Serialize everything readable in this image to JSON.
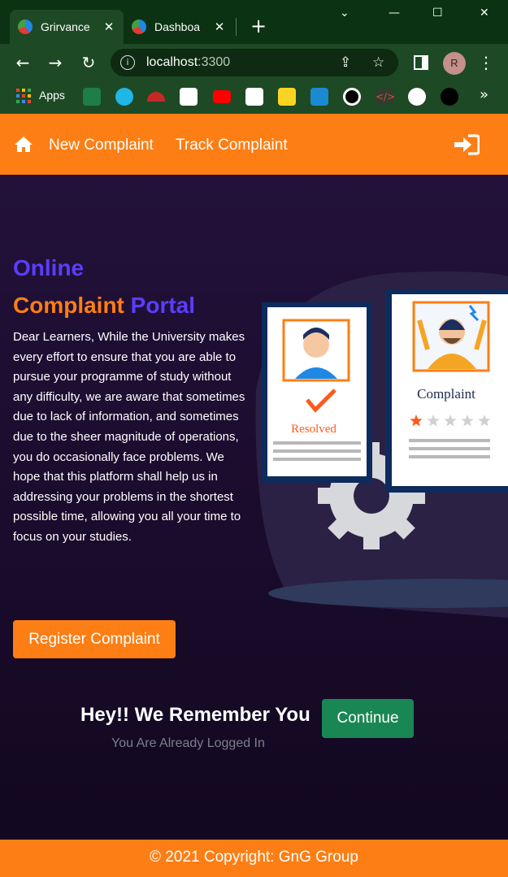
{
  "browser": {
    "tabs": [
      {
        "title": "Grirvance",
        "close": "✕"
      },
      {
        "title": "Dashboa",
        "close": "✕"
      }
    ],
    "new_tab": "+",
    "address": {
      "host": "localhost",
      "port": ":3300"
    },
    "profile_initial": "R",
    "bookmarks": {
      "apps_label": "Apps",
      "overflow": "»"
    }
  },
  "navbar": {
    "links": [
      "New Complaint",
      "Track Complaint"
    ],
    "colors": {
      "bar": "#fd7e14"
    }
  },
  "hero": {
    "title_line1": "Online",
    "title_line2_a": "Complaint",
    "title_line2_b": "Portal",
    "description": "Dear Learners, While the University makes every effort to ensure that you are able to pursue your programme of study without any difficulty, we are aware that sometimes due to lack of information, and sometimes due to the sheer magnitude of operations, you do occasionally face problems. We hope that this platform shall help us in addressing your problems in the shortest possible time, allowing you all your time to focus on your studies.",
    "register_button": "Register Complaint",
    "illustration": {
      "card_resolved": "Resolved",
      "card_complaint": "Complaint",
      "rating": 1,
      "rating_max": 5
    }
  },
  "session": {
    "heading": "Hey!! We Remember You",
    "continue_button": "Continue",
    "subtitle": "You Are Already Logged In"
  },
  "footer": {
    "text": "© 2021 Copyright: GnG Group"
  }
}
